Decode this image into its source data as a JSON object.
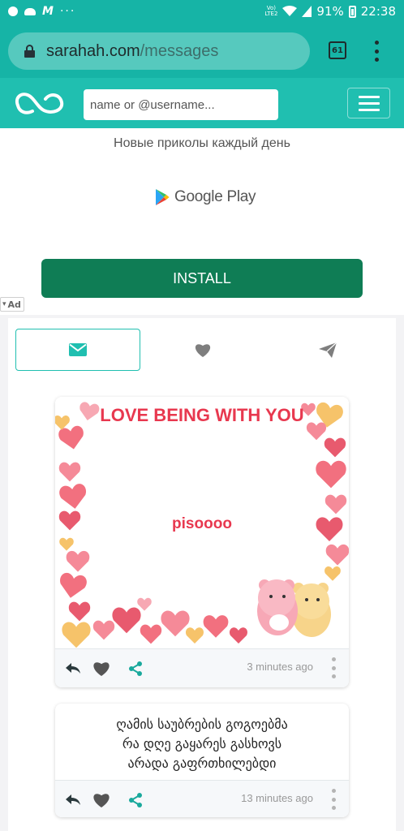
{
  "status_bar": {
    "left_icons": [
      "facebook-icon",
      "cloud-icon",
      "m-app-icon",
      "more-notifications-icon"
    ],
    "more": "···",
    "network": "VoLTE 2",
    "battery_percent": "91%",
    "time": "22:38"
  },
  "browser": {
    "url_host": "sarahah.com",
    "url_path": "/messages",
    "tab_count": "61"
  },
  "header": {
    "search_placeholder": "name or @username..."
  },
  "ad": {
    "headline": "Новые приколы каждый день",
    "store_label": "Google Play",
    "install_label": "INSTALL",
    "badge": "Ad"
  },
  "tabs": [
    {
      "name": "received",
      "icon": "envelope-icon",
      "active": true
    },
    {
      "name": "favorites",
      "icon": "heart-icon",
      "active": false
    },
    {
      "name": "sent",
      "icon": "paper-plane-icon",
      "active": false
    }
  ],
  "messages": [
    {
      "image_heading": "LOVE BEING WITH YOU",
      "image_text": "pisoooo",
      "time": "3 minutes ago"
    },
    {
      "text": "ღამის საუბრების გოგოებმა\nრა დღე გაყარეს გასხოვს\nარადა გაფრთხილებდი",
      "time": "13 minutes ago"
    }
  ],
  "colors": {
    "teal": "#20bfb0",
    "status_teal": "#16b4a6",
    "install_green": "#0f7d55",
    "heart_pink": "#f2707f",
    "heading_red": "#e8384f"
  }
}
